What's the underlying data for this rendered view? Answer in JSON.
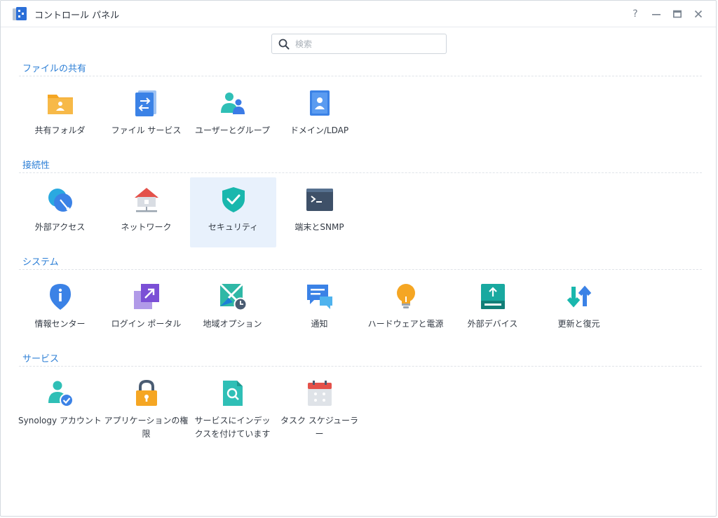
{
  "window": {
    "title": "コントロール パネル",
    "controls": {
      "help": "?",
      "minimize": "—",
      "maximize": "▭",
      "close": "✕"
    }
  },
  "search": {
    "placeholder": "検索",
    "value": ""
  },
  "sections": [
    {
      "title": "ファイルの共有",
      "items": [
        "共有フォルダ",
        "ファイル サービス",
        "ユーザーとグループ",
        "ドメイン/LDAP"
      ]
    },
    {
      "title": "接続性",
      "items": [
        "外部アクセス",
        "ネットワーク",
        "セキュリティ",
        "端末とSNMP"
      ]
    },
    {
      "title": "システム",
      "items": [
        "情報センター",
        "ログイン ポータル",
        "地域オプション",
        "通知",
        "ハードウェアと電源",
        "外部デバイス",
        "更新と復元"
      ]
    },
    {
      "title": "サービス",
      "items": [
        "Synology アカウント",
        "アプリケーションの権限",
        "サービスにインデックスを付けています",
        "タスク スケジューラー"
      ]
    }
  ],
  "selected_item": "セキュリティ",
  "icons": {
    "shared-folder": "folder-user-icon",
    "file-services": "file-transfer-icon",
    "user-group": "users-icon",
    "domain-ldap": "directory-icon",
    "external-access": "globe-icon",
    "network": "house-network-icon",
    "security": "shield-check-icon",
    "terminal": "terminal-icon"
  },
  "colors": {
    "accent": "#2d7fd6",
    "selected_bg": "#e8f1fc"
  }
}
